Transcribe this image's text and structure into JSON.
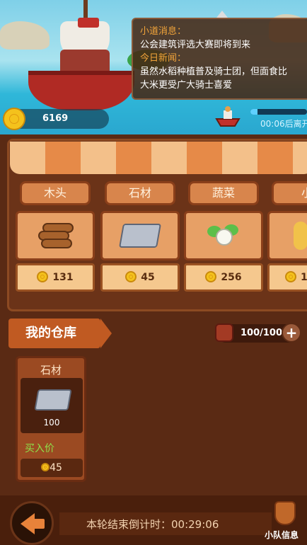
{
  "header": {
    "gold": "6169",
    "depart_text": "00:06后离开",
    "depart_progress": 0.12
  },
  "news": {
    "label1": "小道消息：",
    "text1": "公会建筑评选大赛即将到来",
    "label2": "今日新闻：",
    "text2_line1": "虽然水稻种植普及骑士团，但面食比",
    "text2_line2": "大米更受广大骑士喜爱"
  },
  "market": {
    "items": [
      {
        "name": "木头",
        "price": "131",
        "icon": "wood-icon"
      },
      {
        "name": "石材",
        "price": "45",
        "icon": "stone-icon"
      },
      {
        "name": "蔬菜",
        "price": "256",
        "icon": "vegetable-icon"
      },
      {
        "name": "小",
        "price": "1",
        "icon": "wheat-icon"
      }
    ]
  },
  "warehouse": {
    "title": "我的仓库",
    "capacity": "100/100",
    "item": {
      "name": "石材",
      "qty": "100",
      "buy_label": "买入价",
      "buy_price": "45"
    }
  },
  "footer": {
    "countdown": "本轮结束倒计时：00:29:06",
    "team_label": "小队信息"
  },
  "colors": {
    "accent": "#e8823a",
    "coin": "#f4c21c",
    "buy_green": "#8ee04a"
  }
}
